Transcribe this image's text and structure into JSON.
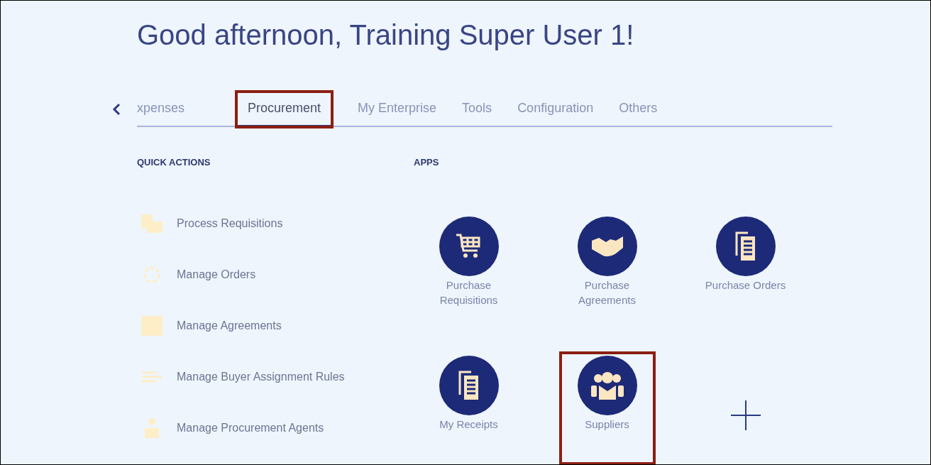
{
  "greeting": "Good afternoon, Training Super User 1!",
  "tabs": [
    {
      "label": "xpenses",
      "selected": false,
      "highlighted": false
    },
    {
      "label": "Procurement",
      "selected": true,
      "highlighted": true
    },
    {
      "label": "My Enterprise",
      "selected": false,
      "highlighted": false
    },
    {
      "label": "Tools",
      "selected": false,
      "highlighted": false
    },
    {
      "label": "Configuration",
      "selected": false,
      "highlighted": false
    },
    {
      "label": "Others",
      "selected": false,
      "highlighted": false
    }
  ],
  "quick_actions": {
    "heading": "QUICK ACTIONS",
    "items": [
      {
        "label": "Process Requisitions"
      },
      {
        "label": "Manage Orders"
      },
      {
        "label": "Manage Agreements"
      },
      {
        "label": "Manage Buyer Assignment Rules"
      },
      {
        "label": "Manage Procurement Agents"
      }
    ]
  },
  "apps": {
    "heading": "APPS",
    "items": [
      {
        "kind": "app",
        "label": "Purchase Requisitions",
        "highlighted": false
      },
      {
        "kind": "app",
        "label": "Purchase Agreements",
        "highlighted": false
      },
      {
        "kind": "app",
        "label": "Purchase Orders",
        "highlighted": false
      },
      {
        "kind": "app",
        "label": "My Receipts",
        "highlighted": false
      },
      {
        "kind": "app",
        "label": "Suppliers",
        "highlighted": true
      },
      {
        "kind": "add"
      }
    ]
  }
}
